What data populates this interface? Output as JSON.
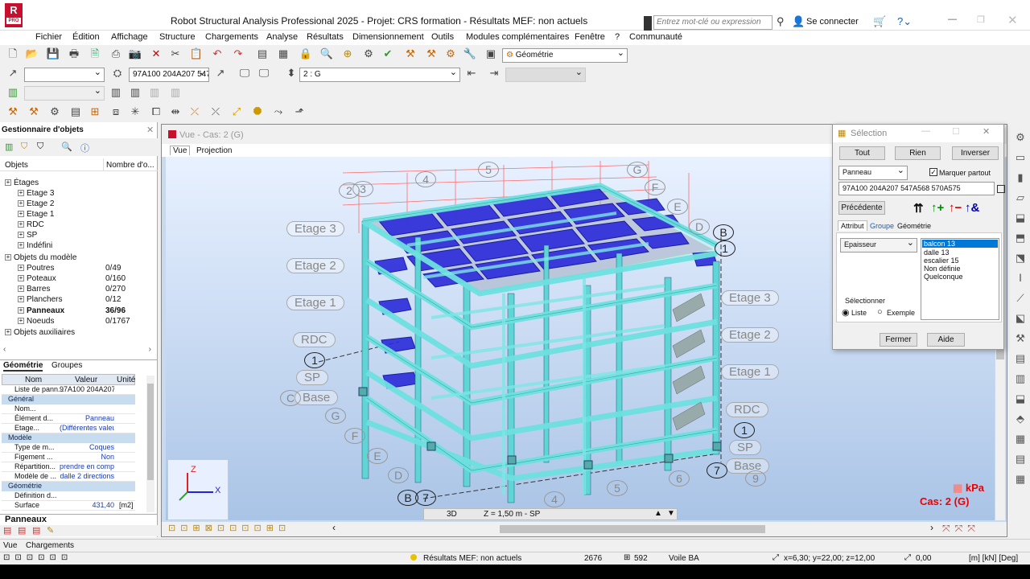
{
  "app": {
    "title": "Robot Structural Analysis Professional 2025 - Projet: CRS formation - Résultats MEF: non actuels",
    "logo_text": "R",
    "logo_sub": "PRO",
    "search_placeholder": "Entrez mot-clé ou expression",
    "signin": "Se connecter"
  },
  "menu": [
    "Fichier",
    "Édition",
    "Affichage",
    "Structure",
    "Chargements",
    "Analyse",
    "Résultats",
    "Dimensionnement",
    "Outils",
    "Modules complémentaires",
    "Fenêtre",
    "?",
    "Communauté"
  ],
  "toolbar": {
    "layout_combo": "Géométrie",
    "selection_combo": "97A100 204A207 547",
    "case_combo": "2 : G"
  },
  "object_manager": {
    "title": "Gestionnaire d'objets",
    "col_objects": "Objets",
    "col_count": "Nombre d'o...",
    "tree": [
      {
        "label": "Étages",
        "indent": 0,
        "count": ""
      },
      {
        "label": "Etage 3",
        "indent": 1,
        "count": ""
      },
      {
        "label": "Etage 2",
        "indent": 1,
        "count": ""
      },
      {
        "label": "Etage 1",
        "indent": 1,
        "count": ""
      },
      {
        "label": "RDC",
        "indent": 1,
        "count": ""
      },
      {
        "label": "SP",
        "indent": 1,
        "count": ""
      },
      {
        "label": "Indéfini",
        "indent": 1,
        "count": ""
      },
      {
        "label": "Objets du modèle",
        "indent": 0,
        "count": ""
      },
      {
        "label": "Poutres",
        "indent": 1,
        "count": "0/49"
      },
      {
        "label": "Poteaux",
        "indent": 1,
        "count": "0/160"
      },
      {
        "label": "Barres",
        "indent": 1,
        "count": "0/270"
      },
      {
        "label": "Planchers",
        "indent": 1,
        "count": "0/12"
      },
      {
        "label": "Panneaux",
        "indent": 1,
        "count": "36/96",
        "bold": true
      },
      {
        "label": "Noeuds",
        "indent": 1,
        "count": "0/1767"
      },
      {
        "label": "Objets auxiliaires",
        "indent": 0,
        "count": ""
      }
    ],
    "tabs": [
      "Géométrie",
      "Groupes"
    ]
  },
  "properties": {
    "headers": [
      "Nom",
      "Valeur",
      "Unité"
    ],
    "rows": [
      {
        "name": "Liste de pann...",
        "value": "97A100 204A207 5...",
        "unit": "",
        "cat": false
      },
      {
        "name": "Général",
        "value": "",
        "unit": "",
        "cat": true
      },
      {
        "name": "Nom...",
        "value": "",
        "unit": "",
        "cat": false
      },
      {
        "name": "Élément d...",
        "value": "Panneau",
        "unit": "",
        "cat": false
      },
      {
        "name": "Etage...",
        "value": "(Différentes valeu",
        "unit": "",
        "cat": false
      },
      {
        "name": "Modèle",
        "value": "",
        "unit": "",
        "cat": true
      },
      {
        "name": "Type de m...",
        "value": "Coques",
        "unit": "",
        "cat": false
      },
      {
        "name": "Figement ...",
        "value": "Non",
        "unit": "",
        "cat": false
      },
      {
        "name": "Répartition...",
        "value": "prendre en comp",
        "unit": "",
        "cat": false
      },
      {
        "name": "Modèle de ...",
        "value": "dalle 2 directions",
        "unit": "",
        "cat": false
      },
      {
        "name": "Géométrie",
        "value": "",
        "unit": "",
        "cat": true
      },
      {
        "name": "Définition d...",
        "value": "",
        "unit": "",
        "cat": false
      },
      {
        "name": "Surface",
        "value": "431,40",
        "unit": "[m2]",
        "cat": false
      }
    ],
    "footer_tab": "Panneaux"
  },
  "view": {
    "title": "Vue - Cas: 2 (G)",
    "tabs": [
      "Vue",
      "Projection"
    ],
    "mode_3d": "3D",
    "z_level": "Z = 1,50 m - SP",
    "unit_label": "kPa",
    "case_label": "Cas: 2 (G)",
    "level_labels_left": [
      "Etage 3",
      "Etage 2",
      "Etage 1",
      "RDC",
      "SP",
      "Base"
    ],
    "level_labels_right": [
      "Etage 3",
      "Etage 2",
      "Etage 1",
      "RDC",
      "SP",
      "Base"
    ],
    "axis_letters": [
      "G",
      "F",
      "E",
      "D",
      "B",
      "C",
      "E",
      "F",
      "G",
      "B",
      "D"
    ],
    "axis_numbers": [
      "1",
      "2",
      "3",
      "4",
      "5",
      "6",
      "7",
      "8",
      "9",
      "1",
      "1",
      "7"
    ],
    "axes": {
      "z": "Z",
      "x": "X"
    }
  },
  "selection_dialog": {
    "title": "Sélection",
    "btn_all": "Tout",
    "btn_none": "Rien",
    "btn_invert": "Inverser",
    "type_combo": "Panneau",
    "mark_everywhere": "Marquer partout",
    "mark_checked": true,
    "selection_text": "97A100 204A207 547A568 570A575",
    "btn_previous": "Précédente",
    "tabs": [
      "Attribut",
      "Groupe",
      "Géométrie"
    ],
    "attribute_combo": "Epaisseur",
    "values": [
      "balcon 13",
      "dalle 13",
      "escalier 15",
      "Non définie",
      "Quelconque"
    ],
    "selected_index": 0,
    "select_group": "Sélectionner",
    "radio_list": "Liste",
    "radio_example": "Exemple",
    "btn_close": "Fermer",
    "btn_help": "Aide"
  },
  "bottom_tabs": [
    "Vue",
    "Chargements"
  ],
  "status": {
    "results": "Résultats MEF: non actuels",
    "nodes": "2676",
    "bars": "592",
    "section": "Voile BA",
    "coords": "x=6,30; y=22,00; z=12,00",
    "angle": "0,00",
    "units": "[m] [kN] [Deg]"
  }
}
